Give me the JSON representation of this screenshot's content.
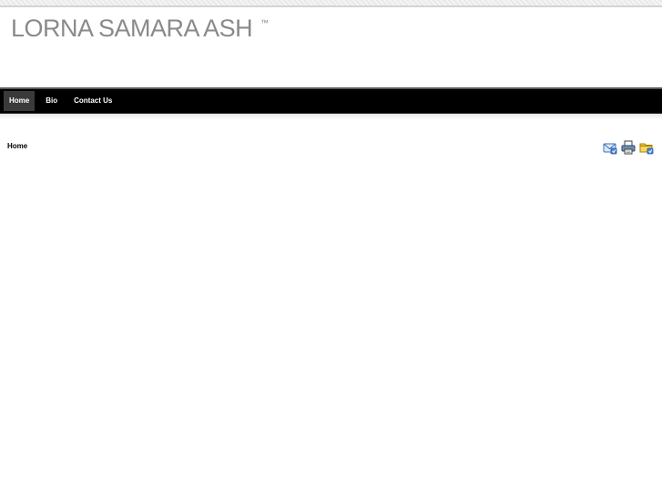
{
  "header": {
    "site_title": "LORNA SAMARA ASH",
    "title_mark": "™"
  },
  "nav": {
    "items": [
      {
        "label": "Home",
        "active": true
      },
      {
        "label": "Bio",
        "active": false
      },
      {
        "label": "Contact Us",
        "active": false
      }
    ]
  },
  "content": {
    "page_heading": "Home",
    "actions": [
      {
        "icon": "email-icon"
      },
      {
        "icon": "print-icon"
      },
      {
        "icon": "folder-icon"
      }
    ]
  },
  "colors": {
    "title_text": "#8a8a8a",
    "nav_background": "#000000",
    "nav_active": "#3a3a3a",
    "icon_blue": "#3b6fb8",
    "icon_yellow": "#f2c22e"
  }
}
